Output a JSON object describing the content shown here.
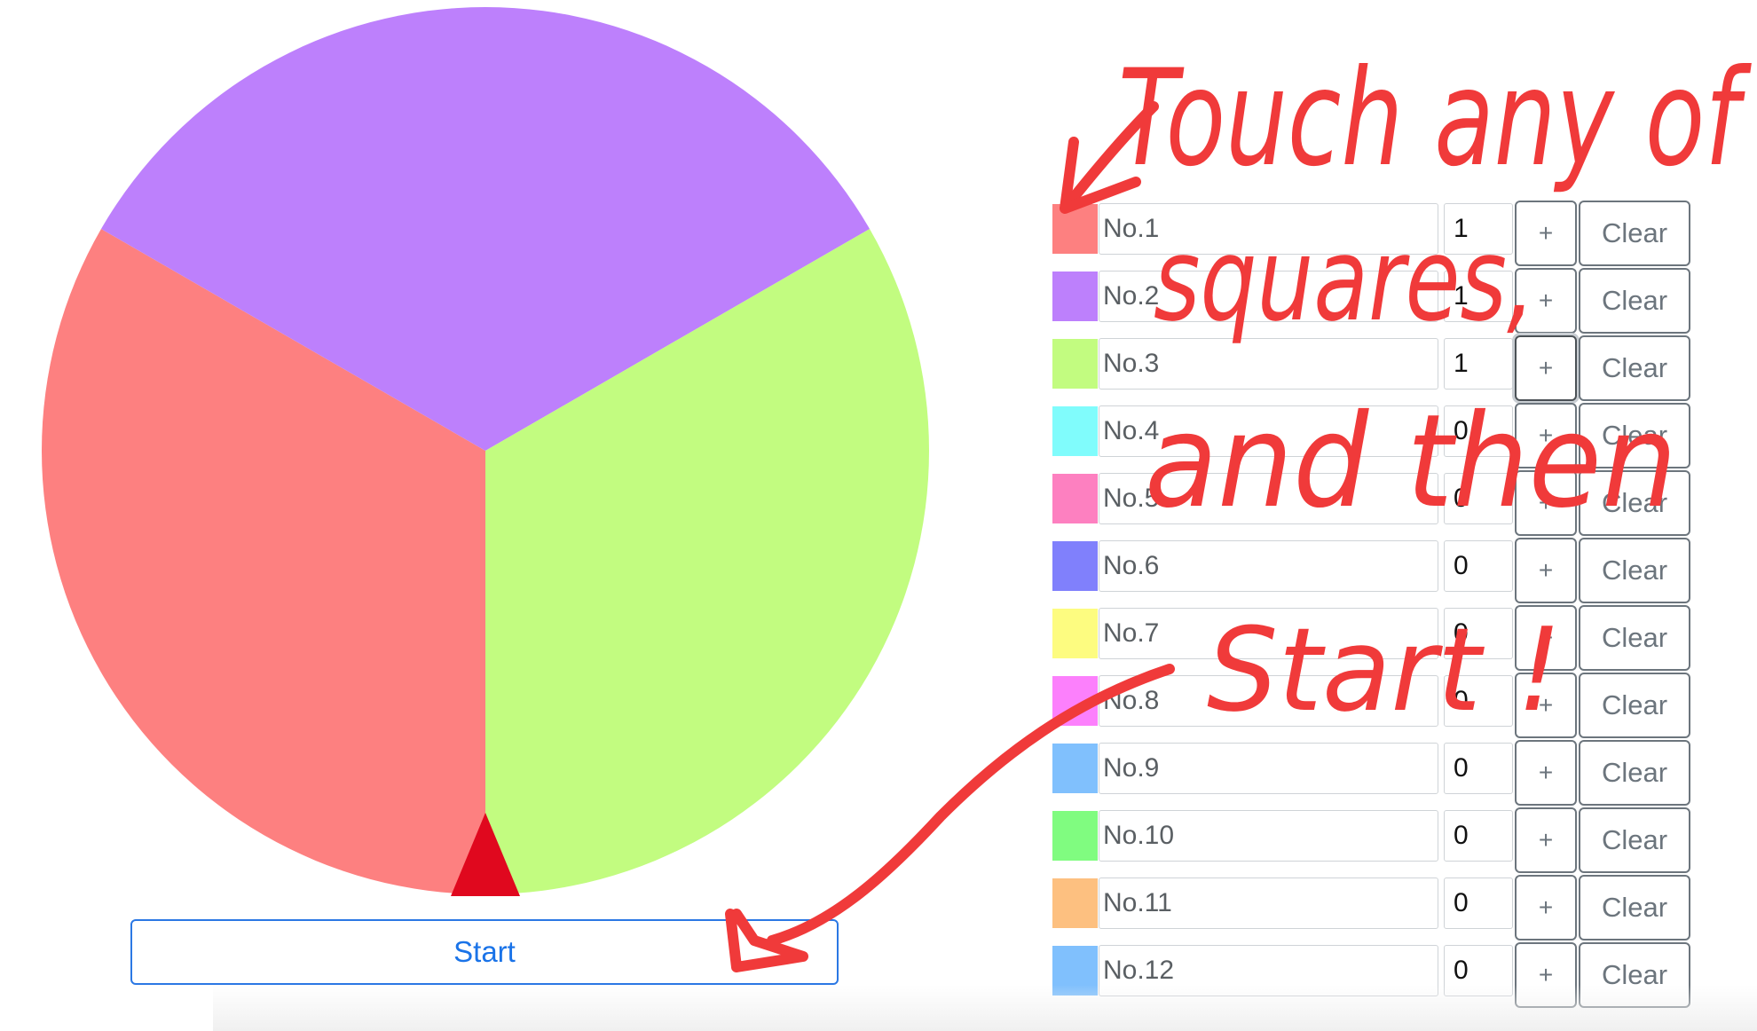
{
  "wheel": {
    "start_label": "Start",
    "pointer_color": "#e0081e",
    "segments": [
      {
        "label": "No.1",
        "color": "#fd8080",
        "count": 1
      },
      {
        "label": "No.2",
        "color": "#bd80fc",
        "count": 1
      },
      {
        "label": "No.3",
        "color": "#c2fc80",
        "count": 1
      }
    ]
  },
  "items": [
    {
      "label": "No.1",
      "count": "1",
      "color": "#fd8080",
      "plus": "+",
      "clear": "Clear"
    },
    {
      "label": "No.2",
      "count": "1",
      "color": "#bd80fc",
      "plus": "+",
      "clear": "Clear"
    },
    {
      "label": "No.3",
      "count": "1",
      "color": "#c2fc80",
      "plus": "+",
      "clear": "Clear"
    },
    {
      "label": "No.4",
      "count": "0",
      "color": "#80fcfc",
      "plus": "+",
      "clear": "Clear"
    },
    {
      "label": "No.5",
      "count": "0",
      "color": "#fd80c0",
      "plus": "+",
      "clear": "Clear"
    },
    {
      "label": "No.6",
      "count": "0",
      "color": "#8080fc",
      "plus": "+",
      "clear": "Clear"
    },
    {
      "label": "No.7",
      "count": "0",
      "color": "#fdfc80",
      "plus": "+",
      "clear": "Clear"
    },
    {
      "label": "No.8",
      "count": "0",
      "color": "#fc80fc",
      "plus": "+",
      "clear": "Clear"
    },
    {
      "label": "No.9",
      "count": "0",
      "color": "#80c0fd",
      "plus": "+",
      "clear": "Clear"
    },
    {
      "label": "No.10",
      "count": "0",
      "color": "#80fc80",
      "plus": "+",
      "clear": "Clear"
    },
    {
      "label": "No.11",
      "count": "0",
      "color": "#fdc080",
      "plus": "+",
      "clear": "Clear"
    },
    {
      "label": "No.12",
      "count": "0",
      "color": "#80c0fd",
      "plus": "+",
      "clear": "Clear"
    }
  ],
  "annotation": {
    "color": "#f03a3a",
    "lines": [
      "Touch any of",
      "squares,",
      "and then",
      "Start !"
    ]
  }
}
